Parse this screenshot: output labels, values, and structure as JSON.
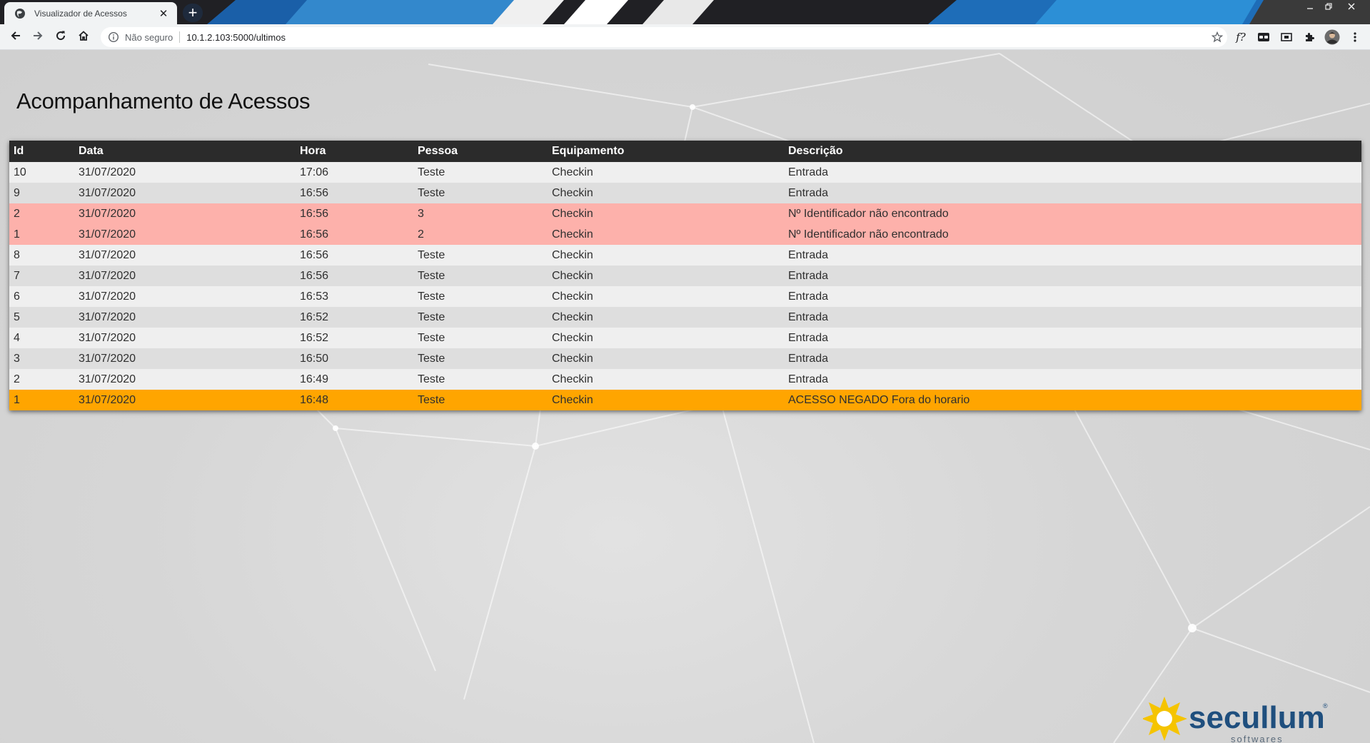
{
  "browser": {
    "tab_title": "Visualizador de Acessos",
    "tab_close": "✕",
    "new_tab": "+",
    "security_label": "Não seguro",
    "url": "10.1.2.103:5000/ultimos",
    "ext_formula": "f?"
  },
  "page": {
    "title": "Acompanhamento de Acessos",
    "columns": [
      "Id",
      "Data",
      "Hora",
      "Pessoa",
      "Equipamento",
      "Descrição"
    ],
    "rows": [
      {
        "id": "10",
        "data": "31/07/2020",
        "hora": "17:06",
        "pessoa": "Teste",
        "equipamento": "Checkin",
        "descricao": "Entrada",
        "status": "normal"
      },
      {
        "id": "9",
        "data": "31/07/2020",
        "hora": "16:56",
        "pessoa": "Teste",
        "equipamento": "Checkin",
        "descricao": "Entrada",
        "status": "normal"
      },
      {
        "id": "2",
        "data": "31/07/2020",
        "hora": "16:56",
        "pessoa": "3",
        "equipamento": "Checkin",
        "descricao": "Nº Identificador não encontrado",
        "status": "error"
      },
      {
        "id": "1",
        "data": "31/07/2020",
        "hora": "16:56",
        "pessoa": "2",
        "equipamento": "Checkin",
        "descricao": "Nº Identificador não encontrado",
        "status": "error"
      },
      {
        "id": "8",
        "data": "31/07/2020",
        "hora": "16:56",
        "pessoa": "Teste",
        "equipamento": "Checkin",
        "descricao": "Entrada",
        "status": "normal"
      },
      {
        "id": "7",
        "data": "31/07/2020",
        "hora": "16:56",
        "pessoa": "Teste",
        "equipamento": "Checkin",
        "descricao": "Entrada",
        "status": "normal"
      },
      {
        "id": "6",
        "data": "31/07/2020",
        "hora": "16:53",
        "pessoa": "Teste",
        "equipamento": "Checkin",
        "descricao": "Entrada",
        "status": "normal"
      },
      {
        "id": "5",
        "data": "31/07/2020",
        "hora": "16:52",
        "pessoa": "Teste",
        "equipamento": "Checkin",
        "descricao": "Entrada",
        "status": "normal"
      },
      {
        "id": "4",
        "data": "31/07/2020",
        "hora": "16:52",
        "pessoa": "Teste",
        "equipamento": "Checkin",
        "descricao": "Entrada",
        "status": "normal"
      },
      {
        "id": "3",
        "data": "31/07/2020",
        "hora": "16:50",
        "pessoa": "Teste",
        "equipamento": "Checkin",
        "descricao": "Entrada",
        "status": "normal"
      },
      {
        "id": "2",
        "data": "31/07/2020",
        "hora": "16:49",
        "pessoa": "Teste",
        "equipamento": "Checkin",
        "descricao": "Entrada",
        "status": "normal"
      },
      {
        "id": "1",
        "data": "31/07/2020",
        "hora": "16:48",
        "pessoa": "Teste",
        "equipamento": "Checkin",
        "descricao": "ACESSO NEGADO Fora do horario",
        "status": "denied"
      }
    ]
  },
  "logo": {
    "name": "secullum",
    "tagline": "softwares",
    "trademark": "®"
  },
  "colors": {
    "header_bg": "#2b2b2b",
    "row_odd": "#efefef",
    "row_even": "#dedede",
    "row_error": "#fdb1ab",
    "row_denied": "#ffa500",
    "logo_blue": "#1f4f7e",
    "logo_yellow": "#f5c400"
  },
  "icons": [
    "globe-icon",
    "close-icon",
    "plus-icon",
    "minimize-icon",
    "restore-icon",
    "window-close-icon",
    "back-arrow-icon",
    "forward-arrow-icon",
    "reload-icon",
    "home-icon",
    "info-icon",
    "star-icon",
    "formula-icon",
    "reading-mode-icon",
    "media-icon",
    "puzzle-icon",
    "avatar",
    "kebab-menu-icon"
  ]
}
